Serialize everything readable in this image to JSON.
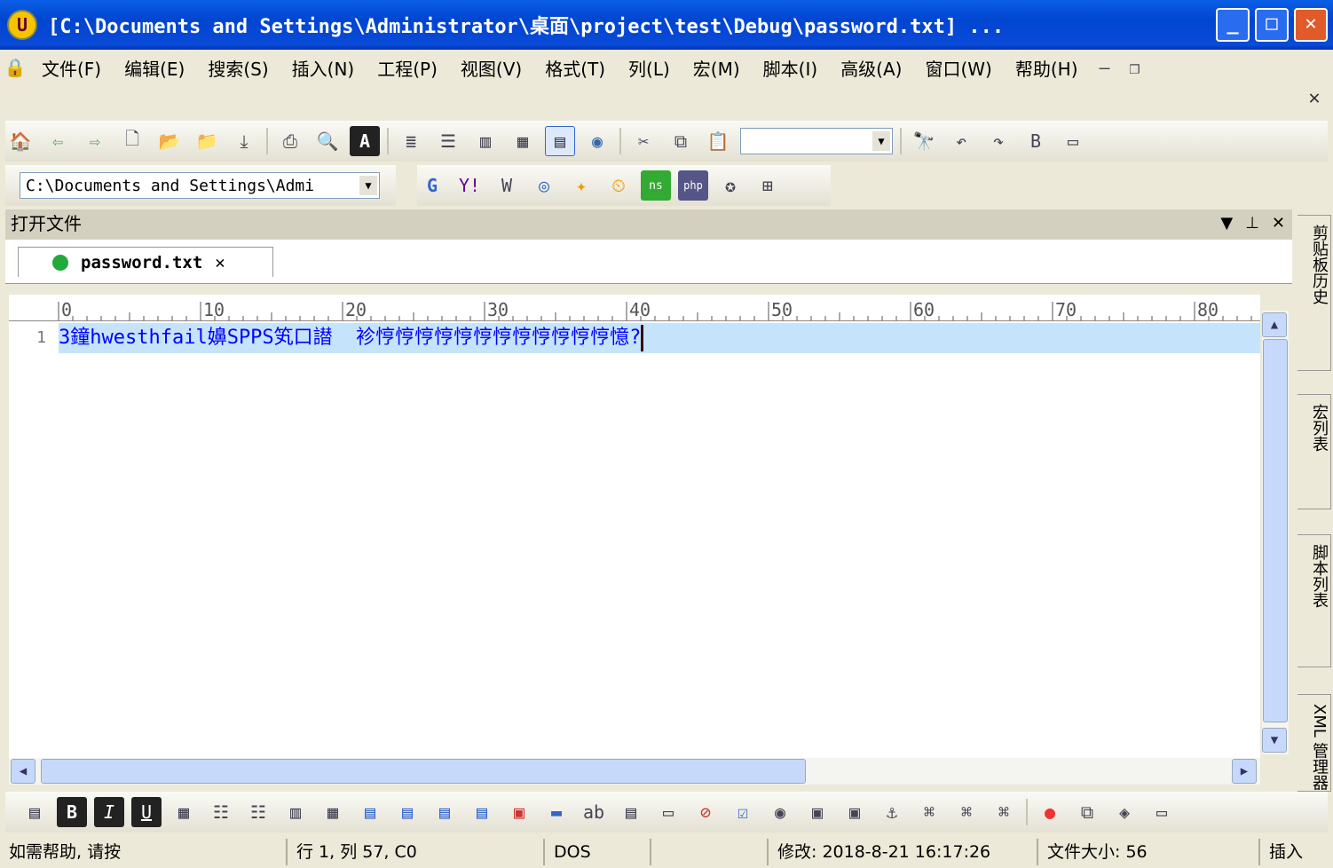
{
  "window": {
    "title": "[C:\\Documents and Settings\\Administrator\\桌面\\project\\test\\Debug\\password.txt] ..."
  },
  "menu": [
    "文件(F)",
    "编辑(E)",
    "搜索(S)",
    "插入(N)",
    "工程(P)",
    "视图(V)",
    "格式(T)",
    "列(L)",
    "宏(M)",
    "脚本(I)",
    "高级(A)",
    "窗口(W)",
    "帮助(H)"
  ],
  "path_combo": "C:\\Documents and Settings\\Admi",
  "panel": {
    "title": "打开文件"
  },
  "tab": {
    "label": "password.txt"
  },
  "ruler": [
    "0",
    "10",
    "20",
    "30",
    "40",
    "50",
    "60",
    "70",
    "80"
  ],
  "editor": {
    "line_number": "1",
    "line_text": "3鐘hwesthfail嬶SPPS笂口譛  袗悙悙悙悙悙悙悙悙悙悙悙悙憶?"
  },
  "side_tabs": [
    "剪贴板历史",
    "宏列表",
    "脚本列表",
    "XML 管理器"
  ],
  "status": {
    "help": "如需帮助, 请按",
    "position": "行 1, 列 57, C0",
    "format": "DOS",
    "modified": "修改: 2018-8-21 16:17:26",
    "size": "文件大小: 56",
    "mode": "插入"
  },
  "colors": {
    "selection": "#c5e4fb",
    "text": "#0000ff",
    "titlebar": "#0a5fe6"
  }
}
